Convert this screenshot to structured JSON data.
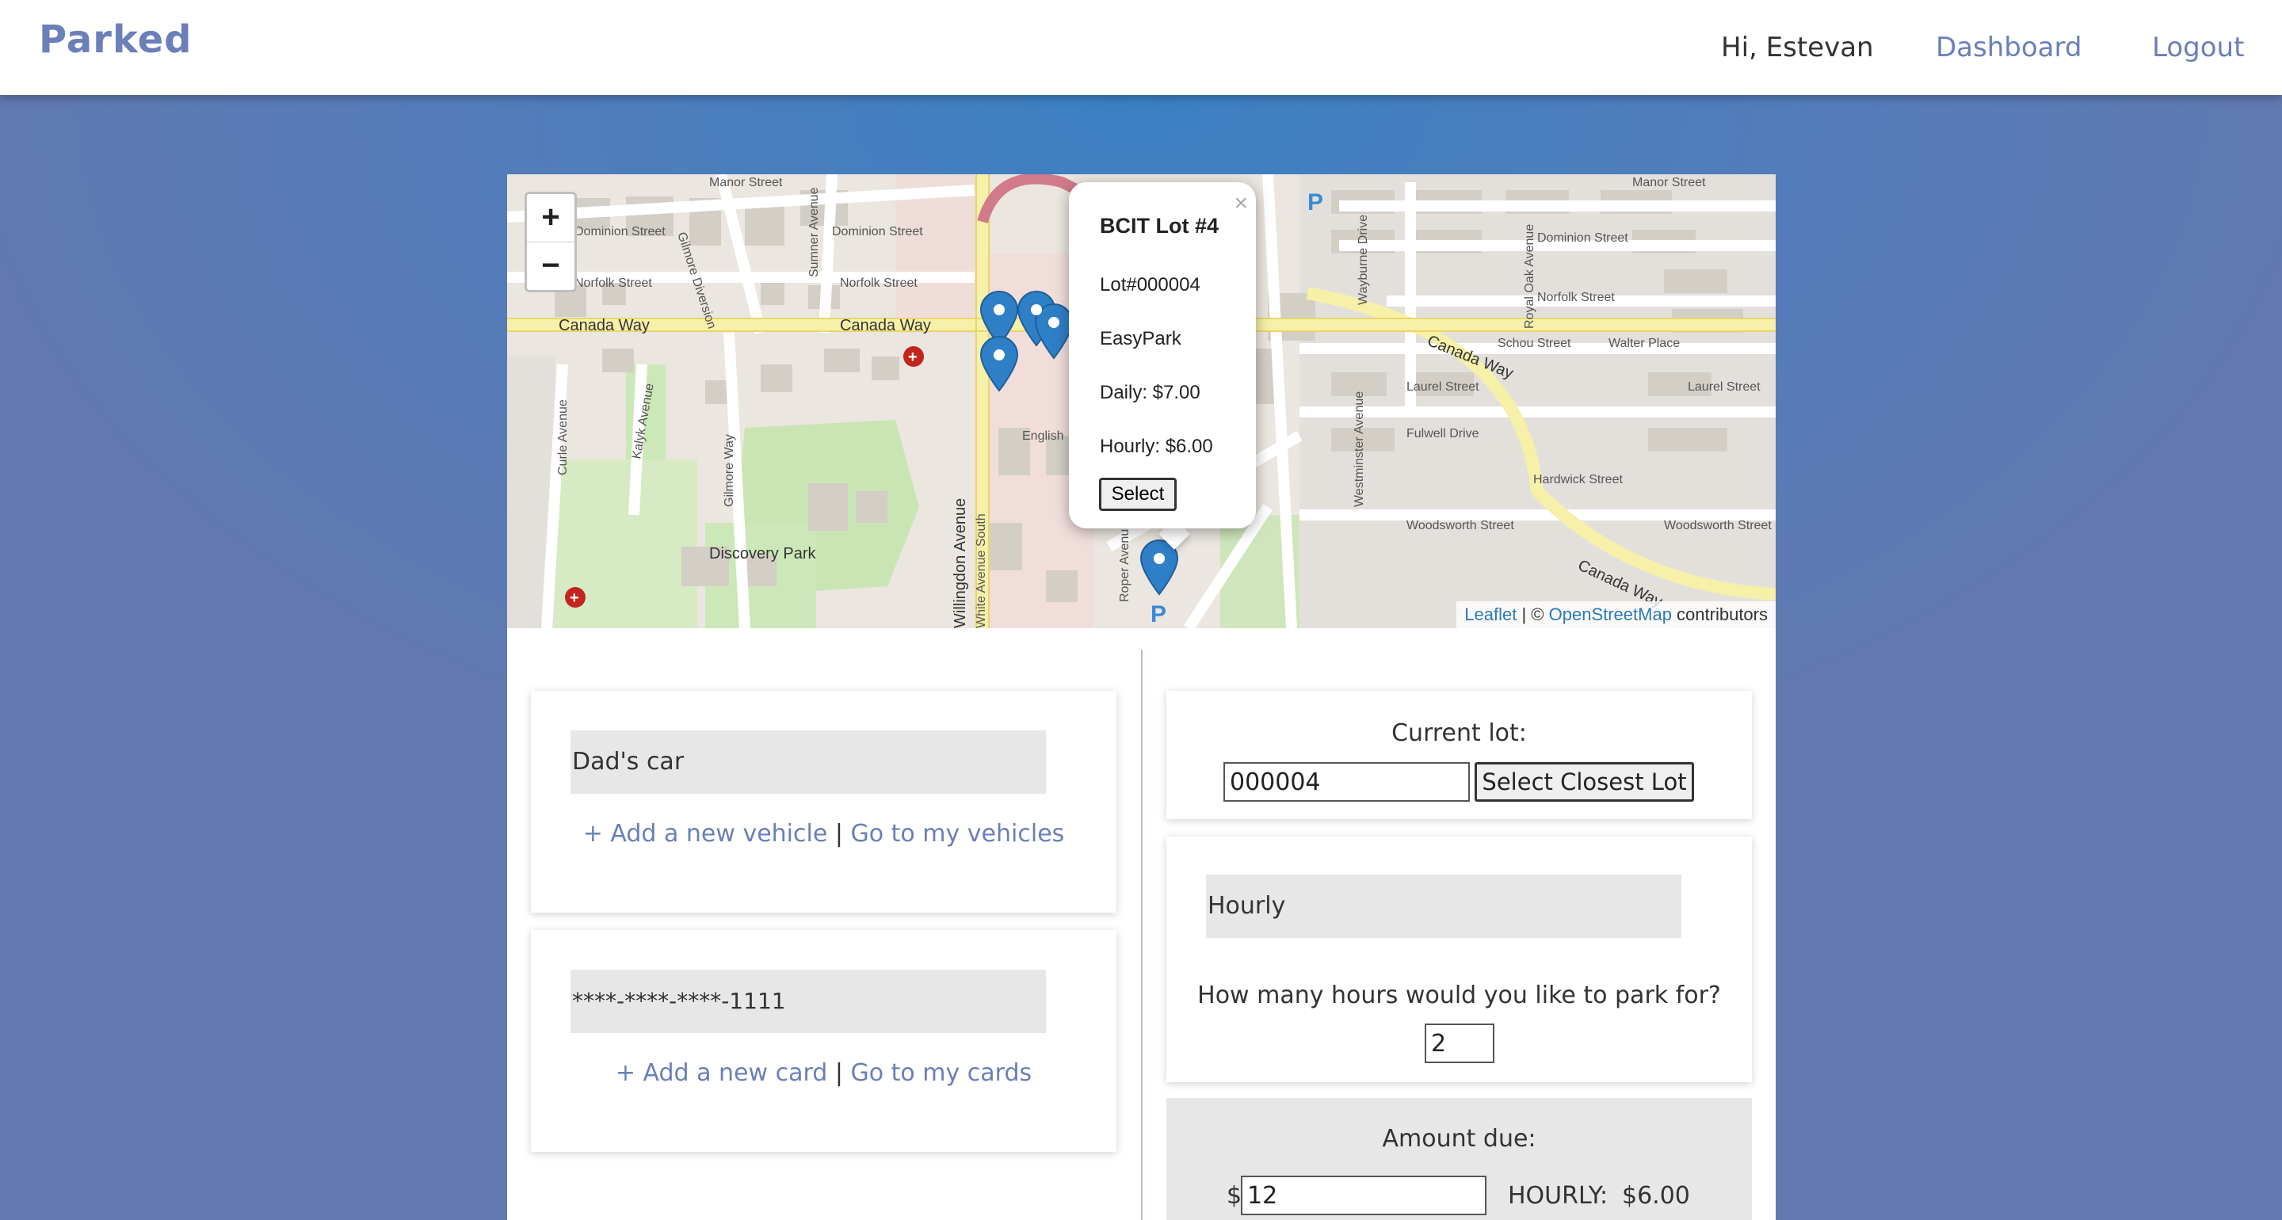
{
  "navbar": {
    "brand": "Parked",
    "greeting": "Hi, Estevan",
    "dashboard_link": "Dashboard",
    "logout_link": "Logout"
  },
  "map": {
    "zoom_in": "+",
    "zoom_out": "−",
    "streets": [
      "Manor Street",
      "Dominion Street",
      "Norfolk Street",
      "Canada Way",
      "Gilmore Diversion",
      "Sumner Avenue",
      "Curle Avenue",
      "Kalyk Avenue",
      "Gilmore Way",
      "Discovery Park",
      "Willingdon Avenue",
      "English",
      "Roper Avenue",
      "Schou Street",
      "Walter Place",
      "Laurel Street",
      "Fulwell Drive",
      "Hardwick Street",
      "Woodsworth Street",
      "Westminster Avenue",
      "Wayburne Drive",
      "Royal Oak Avenue",
      "White Avenue South"
    ],
    "popup": {
      "close": "×",
      "title": "BCIT Lot #4",
      "lot_number": "Lot#000004",
      "operator": "EasyPark",
      "daily": "Daily: $7.00",
      "hourly": "Hourly: $6.00",
      "select_button": "Select"
    },
    "attribution": {
      "leaflet": "Leaflet",
      "separator": " | © ",
      "osm": "OpenStreetMap",
      "suffix": " contributors"
    }
  },
  "vehicle": {
    "selected": "Dad's car",
    "add_link": "+ Add a new vehicle",
    "separator": " | ",
    "goto_link": "Go to my vehicles"
  },
  "payment_card": {
    "selected": "****-****-****-1111",
    "add_link": "+ Add a new card",
    "separator": " | ",
    "goto_link": "Go to my cards"
  },
  "lot": {
    "label": "Current lot:",
    "value": "000004",
    "closest_button": "Select Closest Lot"
  },
  "rate": {
    "selected": "Hourly",
    "question": "How many hours would you like to park for?",
    "hours": "2"
  },
  "amount": {
    "label": "Amount due:",
    "currency": "$",
    "value": "12",
    "rate_label": "HOURLY:",
    "rate_value": "$6.00"
  },
  "colors": {
    "brand": "#6b7fb8",
    "link": "#6b7fb8",
    "marker": "#2f7fc6"
  }
}
